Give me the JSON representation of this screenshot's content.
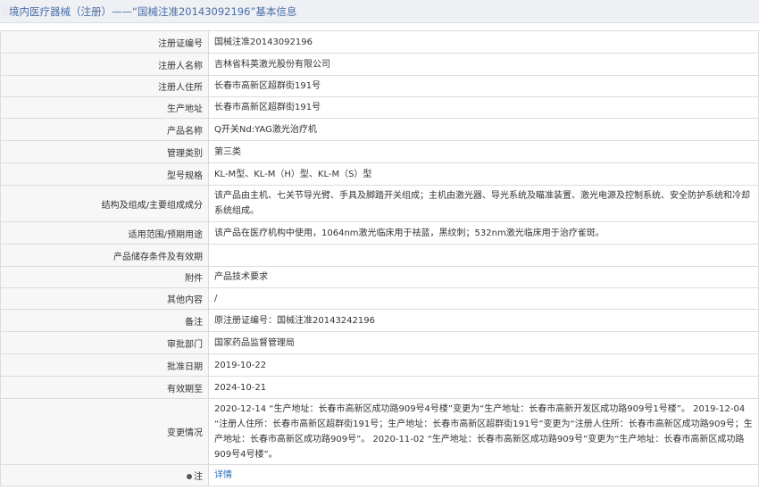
{
  "header": {
    "title": "境内医疗器械（注册）——“国械注准20143092196”基本信息"
  },
  "rows": [
    {
      "label": "注册证编号",
      "value": "国械注准20143092196"
    },
    {
      "label": "注册人名称",
      "value": "吉林省科英激光股份有限公司"
    },
    {
      "label": "注册人住所",
      "value": "长春市高新区超群街191号"
    },
    {
      "label": "生产地址",
      "value": "长春市高新区超群街191号"
    },
    {
      "label": "产品名称",
      "value": "Q开关Nd:YAG激光治疗机"
    },
    {
      "label": "管理类别",
      "value": "第三类"
    },
    {
      "label": "型号规格",
      "value": "KL-M型、KL-M（H）型、KL-M（S）型"
    },
    {
      "label": "结构及组成/主要组成成分",
      "value": "该产品由主机、七关节导光臂、手具及脚踏开关组成；主机由激光器、导光系统及瞄准装置、激光电源及控制系统、安全防护系统和冷却系统组成。"
    },
    {
      "label": "适用范围/预期用途",
      "value": "该产品在医疗机构中使用，1064nm激光临床用于祛蓝，黑纹刺；532nm激光临床用于治疗雀斑。"
    },
    {
      "label": "产品储存条件及有效期",
      "value": ""
    },
    {
      "label": "附件",
      "value": "产品技术要求"
    },
    {
      "label": "其他内容",
      "value": "/"
    },
    {
      "label": "备注",
      "value": "原注册证编号：国械注准20143242196"
    },
    {
      "label": "审批部门",
      "value": "国家药品监督管理局"
    },
    {
      "label": "批准日期",
      "value": "2019-10-22"
    },
    {
      "label": "有效期至",
      "value": "2024-10-21"
    },
    {
      "label": "变更情况",
      "value": "2020-12-14 “生产地址：长春市高新区成功路909号4号楼”变更为“生产地址：长春市高新开发区成功路909号1号楼”。 2019-12-04 “注册人住所：长春市高新区超群街191号；生产地址：长春市高新区超群街191号”变更为“注册人住所：长春市高新区成功路909号；生产地址：长春市高新区成功路909号”。 2020-11-02 “生产地址：长春市高新区成功路909号”变更为“生产地址：长春市高新区成功路909号4号楼”。"
    }
  ],
  "note": {
    "label": "注",
    "icon": "bulb-icon",
    "link_text": "详情"
  },
  "colors": {
    "header_text": "#4a6da7",
    "link": "#2a6ab5",
    "label_bg": "#f7f7f7"
  }
}
